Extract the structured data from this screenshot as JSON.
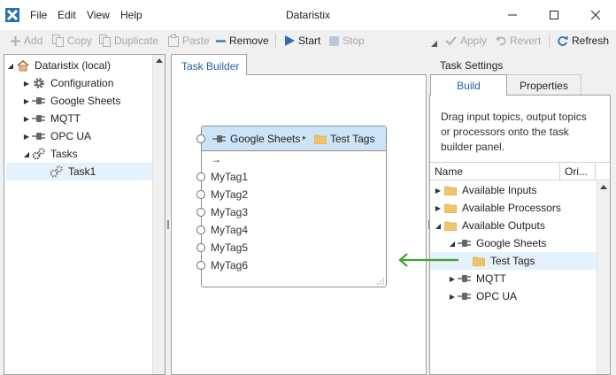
{
  "window": {
    "title": "Dataristix",
    "menu": [
      "File",
      "Edit",
      "View",
      "Help"
    ]
  },
  "toolbar": {
    "add": "Add",
    "copy": "Copy",
    "duplicate": "Duplicate",
    "paste": "Paste",
    "remove": "Remove",
    "start": "Start",
    "stop": "Stop",
    "apply": "Apply",
    "revert": "Revert",
    "refresh": "Refresh"
  },
  "left_tree": {
    "root": "Dataristix (local)",
    "items": [
      "Configuration",
      "Google Sheets",
      "MQTT",
      "OPC UA",
      "Tasks"
    ],
    "task": "Task1"
  },
  "center": {
    "tab": "Task Builder",
    "node": {
      "source": "Google Sheets",
      "separator": "▸",
      "target": "Test Tags",
      "arrow": "→",
      "tags": [
        "MyTag1",
        "MyTag2",
        "MyTag3",
        "MyTag4",
        "MyTag5",
        "MyTag6"
      ]
    }
  },
  "right": {
    "title": "Task Settings",
    "tabs": [
      "Build",
      "Properties"
    ],
    "hint": [
      "Drag input topics, output topics",
      "or processors onto the task",
      "builder panel."
    ],
    "columns": [
      "Name",
      "Ori..."
    ],
    "tree": {
      "inputs": "Available Inputs",
      "processors": "Available Processors",
      "outputs": "Available Outputs",
      "google_sheets": "Google Sheets",
      "test_tags": "Test Tags",
      "mqtt": "MQTT",
      "opcua": "OPC UA"
    }
  },
  "colors": {
    "accent": "#2f8ad8",
    "header_blue": "#cce4f7",
    "selection": "#e5f1fb",
    "arrow_green": "#3ba52b",
    "folder": "#f0c46a"
  }
}
